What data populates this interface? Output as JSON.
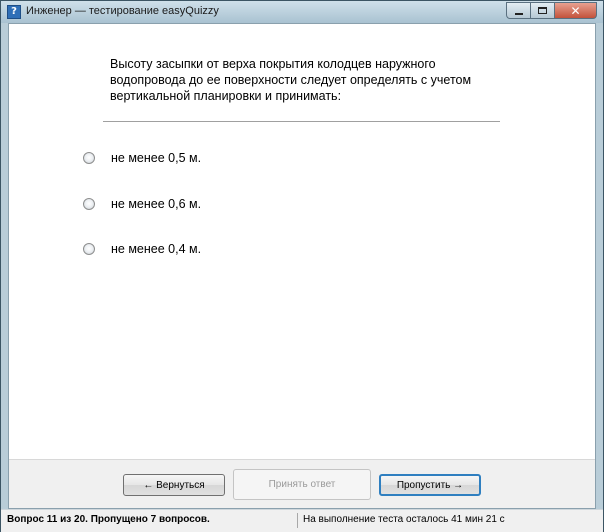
{
  "window": {
    "title": "Инженер — тестирование easyQuizzy",
    "icon": "help-question-icon",
    "close_glyph": "✕"
  },
  "question": {
    "text": "Высоту засыпки от верха покрытия колодцев наружного водопровода до ее поверхности следует определять с учетом вертикальной планировки и принимать:"
  },
  "answers": [
    {
      "label": "не менее 0,5 м.",
      "selected": false
    },
    {
      "label": "не менее 0,6 м.",
      "selected": false
    },
    {
      "label": "не менее 0,4 м.",
      "selected": false
    }
  ],
  "buttons": {
    "back": "← Вернуться",
    "accept": "Принять ответ",
    "skip": "Пропустить →"
  },
  "status": {
    "progress": "Вопрос 11 из 20. Пропущено 7 вопросов.",
    "time_left": "На выполнение теста осталось 41 мин 21 с"
  }
}
